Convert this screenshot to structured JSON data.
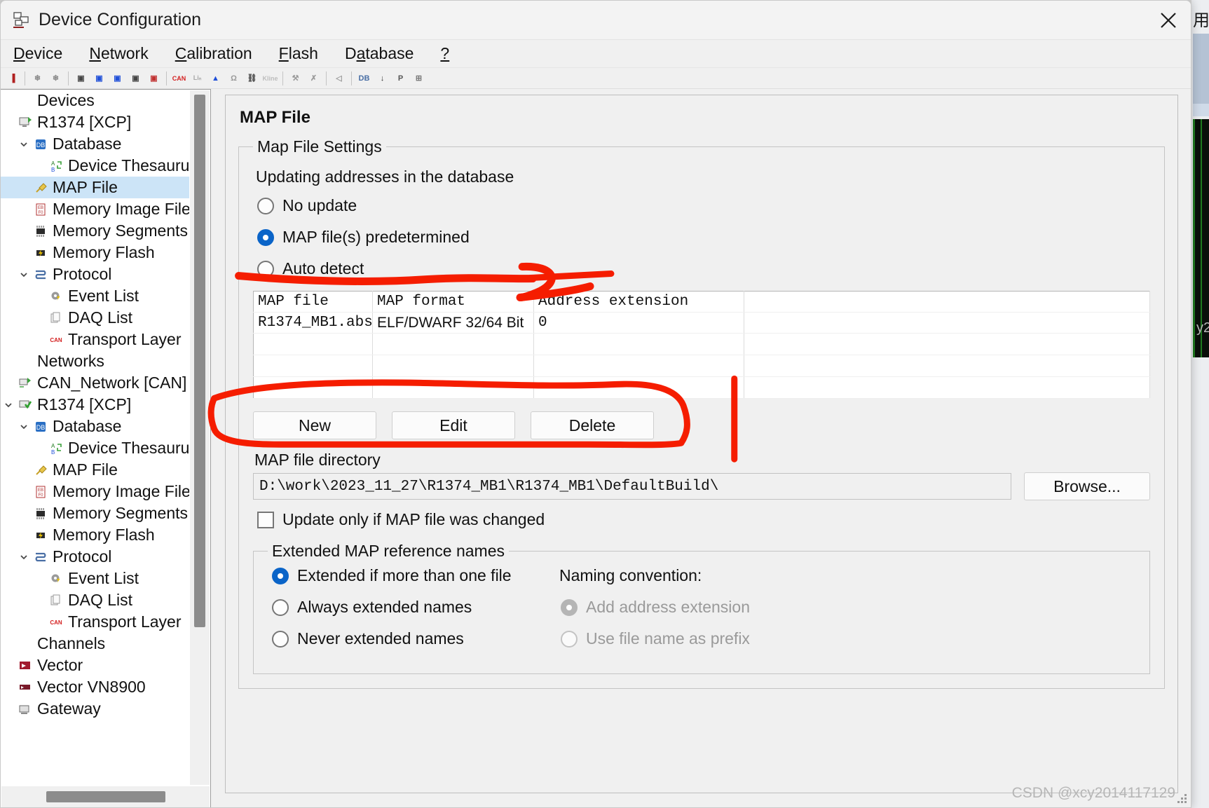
{
  "window": {
    "title": "Device Configuration",
    "icon": "device-config-icon",
    "close_icon": "close-icon"
  },
  "menubar": [
    {
      "label": "Device",
      "accel": "D"
    },
    {
      "label": "Network",
      "accel": "N"
    },
    {
      "label": "Calibration",
      "accel": "C"
    },
    {
      "label": "Flash",
      "accel": "F"
    },
    {
      "label": "Database",
      "accel": "a"
    },
    {
      "label": "?",
      "accel": ""
    }
  ],
  "toolbar": {
    "items": [
      {
        "name": "disconnect-icon",
        "glyph": "▐"
      },
      {
        "sep": true
      },
      {
        "name": "delete-check-icon",
        "glyph": "❄"
      },
      {
        "name": "delete-icon",
        "glyph": "❄"
      },
      {
        "sep": true
      },
      {
        "name": "add-device-icon",
        "glyph": "▣"
      },
      {
        "name": "add-device-blue-icon",
        "glyph": "▣"
      },
      {
        "name": "add-device-globe-icon",
        "glyph": "▣"
      },
      {
        "name": "add-device-mem-icon",
        "glyph": "▣"
      },
      {
        "name": "add-device-red-icon",
        "glyph": "▣"
      },
      {
        "sep": true
      },
      {
        "name": "can-icon",
        "glyph": "CAN"
      },
      {
        "name": "lin-icon",
        "glyph": "Liₙ"
      },
      {
        "name": "flexray-icon",
        "glyph": "▲"
      },
      {
        "name": "most-icon",
        "glyph": "Ω"
      },
      {
        "name": "ethernet-icon",
        "glyph": "⛓"
      },
      {
        "name": "kline-icon",
        "glyph": "Kline"
      },
      {
        "sep": true
      },
      {
        "name": "wrench-icon",
        "glyph": "⚒"
      },
      {
        "name": "disconnect-x-icon",
        "glyph": "✗"
      },
      {
        "sep": true
      },
      {
        "name": "transceiver-icon",
        "glyph": "◁"
      },
      {
        "sep": true
      },
      {
        "name": "database-icon",
        "glyph": "DB"
      },
      {
        "name": "download-icon",
        "glyph": "↓"
      },
      {
        "name": "protocol-icon",
        "glyph": "P"
      },
      {
        "name": "report-icon",
        "glyph": "⊞"
      }
    ]
  },
  "tree": {
    "nodes": [
      {
        "label": "Devices",
        "indent": 0,
        "twisty": "",
        "icon": "",
        "selected": false
      },
      {
        "label": "R1374 [XCP]",
        "indent": 0,
        "twisty": "",
        "icon": "device-icon",
        "selected": false
      },
      {
        "label": "Database",
        "indent": 1,
        "twisty": "v",
        "icon": "database-icon",
        "selected": false
      },
      {
        "label": "Device Thesaurus",
        "indent": 2,
        "twisty": "",
        "icon": "thesaurus-icon",
        "selected": false
      },
      {
        "label": "MAP File",
        "indent": 1,
        "twisty": "",
        "icon": "pin-icon",
        "selected": true
      },
      {
        "label": "Memory Image File",
        "indent": 1,
        "twisty": "",
        "icon": "memimage-icon",
        "selected": false
      },
      {
        "label": "Memory Segments",
        "indent": 1,
        "twisty": "",
        "icon": "memchip-icon",
        "selected": false
      },
      {
        "label": "Memory Flash",
        "indent": 1,
        "twisty": "",
        "icon": "memflash-icon",
        "selected": false
      },
      {
        "label": "Protocol",
        "indent": 1,
        "twisty": "v",
        "icon": "protocol-icon",
        "selected": false
      },
      {
        "label": "Event List",
        "indent": 2,
        "twisty": "",
        "icon": "event-icon",
        "selected": false
      },
      {
        "label": "DAQ List",
        "indent": 2,
        "twisty": "",
        "icon": "daq-icon",
        "selected": false
      },
      {
        "label": "Transport Layer",
        "indent": 2,
        "twisty": "",
        "icon": "can-icon",
        "selected": false
      },
      {
        "label": "Networks",
        "indent": 0,
        "twisty": "",
        "icon": "",
        "selected": false
      },
      {
        "label": "CAN_Network [CAN]",
        "indent": 0,
        "twisty": "",
        "icon": "network-icon",
        "selected": false
      },
      {
        "label": "R1374 [XCP]",
        "indent": 0,
        "twisty": "v",
        "icon": "device-ok-icon",
        "selected": false
      },
      {
        "label": "Database",
        "indent": 1,
        "twisty": "v",
        "icon": "database-icon",
        "selected": false
      },
      {
        "label": "Device Thesaurus",
        "indent": 2,
        "twisty": "",
        "icon": "thesaurus-icon",
        "selected": false
      },
      {
        "label": "MAP File",
        "indent": 1,
        "twisty": "",
        "icon": "pin-icon",
        "selected": false
      },
      {
        "label": "Memory Image File",
        "indent": 1,
        "twisty": "",
        "icon": "memimage-icon",
        "selected": false
      },
      {
        "label": "Memory Segments",
        "indent": 1,
        "twisty": "",
        "icon": "memchip-icon",
        "selected": false
      },
      {
        "label": "Memory Flash",
        "indent": 1,
        "twisty": "",
        "icon": "memflash-icon",
        "selected": false
      },
      {
        "label": "Protocol",
        "indent": 1,
        "twisty": "v",
        "icon": "protocol-icon",
        "selected": false
      },
      {
        "label": "Event List",
        "indent": 2,
        "twisty": "",
        "icon": "event-icon",
        "selected": false
      },
      {
        "label": "DAQ List",
        "indent": 2,
        "twisty": "",
        "icon": "daq-icon",
        "selected": false
      },
      {
        "label": "Transport Layer",
        "indent": 2,
        "twisty": "",
        "icon": "can-icon",
        "selected": false
      },
      {
        "label": "Channels",
        "indent": 0,
        "twisty": "",
        "icon": "",
        "selected": false
      },
      {
        "label": "Vector",
        "indent": 0,
        "twisty": "",
        "icon": "vector-icon",
        "selected": false
      },
      {
        "label": "Vector VN8900",
        "indent": 0,
        "twisty": "",
        "icon": "vn8900-icon",
        "selected": false
      },
      {
        "label": "Gateway",
        "indent": 0,
        "twisty": "",
        "icon": "gateway-icon",
        "selected": false
      }
    ]
  },
  "main": {
    "page_title": "MAP File",
    "map_file_settings": {
      "legend": "Map File Settings",
      "updating_label": "Updating addresses in the database",
      "update_options": [
        {
          "label": "No update",
          "checked": false
        },
        {
          "label": "MAP file(s) predetermined",
          "checked": true
        },
        {
          "label": "Auto detect",
          "checked": false
        }
      ],
      "table": {
        "headers": [
          "MAP file",
          "MAP format",
          "Address extension",
          ""
        ],
        "rows": [
          [
            "R1374_MB1.abs",
            "ELF/DWARF 32/64 Bit",
            "0",
            ""
          ],
          [
            "",
            "",
            "",
            ""
          ],
          [
            "",
            "",
            "",
            ""
          ],
          [
            "",
            "",
            "",
            ""
          ]
        ]
      },
      "buttons": [
        {
          "label": "New",
          "name": "new-button"
        },
        {
          "label": "Edit",
          "name": "edit-button"
        },
        {
          "label": "Delete",
          "name": "delete-button"
        }
      ],
      "directory_label": "MAP file directory",
      "directory_value": "D:\\work\\2023_11_27\\R1374_MB1\\R1374_MB1\\DefaultBuild\\",
      "browse_label": "Browse...",
      "update_changed": {
        "label": "Update only if MAP file was changed",
        "checked": false
      }
    },
    "extended_names": {
      "legend": "Extended MAP reference names",
      "options": [
        {
          "label": "Extended if more than one file",
          "checked": true
        },
        {
          "label": "Always extended names",
          "checked": false
        },
        {
          "label": "Never extended names",
          "checked": false
        }
      ],
      "naming_label": "Naming convention:",
      "naming_options": [
        {
          "label": "Add address extension",
          "checked": true,
          "disabled": true
        },
        {
          "label": "Use file name as prefix",
          "checked": false,
          "disabled": true
        }
      ]
    }
  },
  "background": {
    "cjk_text": "用",
    "scope_label": "y2"
  },
  "watermark": "CSDN @xcy2014117129",
  "colors": {
    "accent": "#0a64c8",
    "selection": "#cce4f7",
    "ink": "#f51d00",
    "window_bg": "#f0f0f0"
  }
}
